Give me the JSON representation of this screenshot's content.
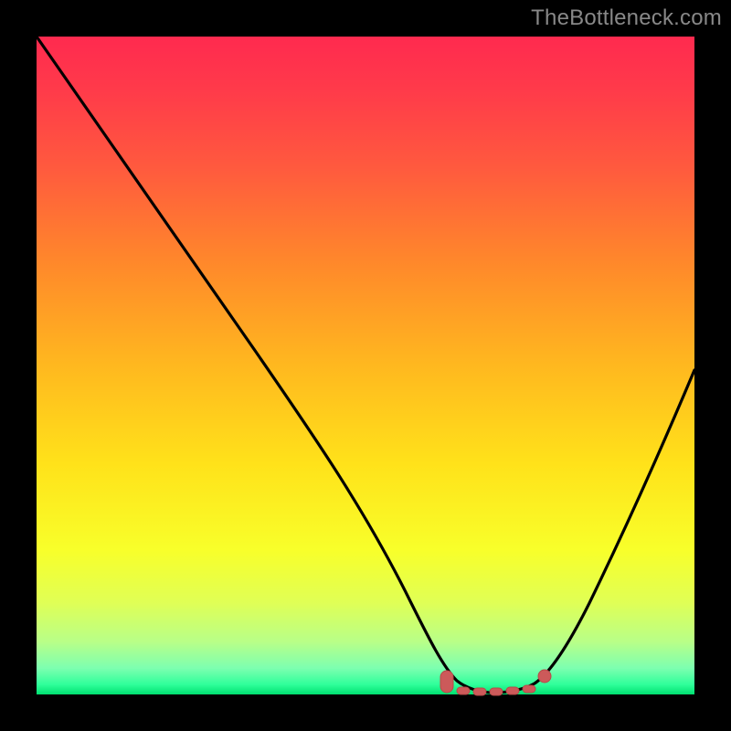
{
  "watermark": "TheBottleneck.com",
  "colors": {
    "curve_stroke": "#000000",
    "marker_fill": "#cc5a5a",
    "marker_stroke": "#b84848",
    "background": "#000000"
  },
  "chart_data": {
    "type": "line",
    "title": "",
    "xlabel": "",
    "ylabel": "",
    "xlim": [
      0,
      100
    ],
    "ylim": [
      0,
      100
    ],
    "grid": false,
    "legend": false,
    "axes_visble": false,
    "series": [
      {
        "name": "bottleneck-curve",
        "x": [
          0,
          5,
          10,
          15,
          20,
          25,
          30,
          35,
          40,
          45,
          50,
          55,
          60,
          62,
          65,
          68,
          70,
          73,
          76,
          80,
          85,
          90,
          95,
          100
        ],
        "values": [
          100,
          92,
          84,
          76,
          68,
          60,
          52,
          44,
          36,
          28,
          20,
          13,
          6,
          3,
          1,
          0,
          0,
          0,
          1,
          4,
          12,
          22,
          34,
          49
        ]
      }
    ],
    "markers": [
      {
        "name": "flat-start",
        "x": 62,
        "y": 2.5,
        "shape": "round-rect"
      },
      {
        "name": "flat-mid1",
        "x": 65,
        "y": 1.2,
        "shape": "dot"
      },
      {
        "name": "flat-mid2",
        "x": 68,
        "y": 0.8,
        "shape": "dot"
      },
      {
        "name": "flat-mid3",
        "x": 71,
        "y": 0.8,
        "shape": "dot"
      },
      {
        "name": "flat-mid4",
        "x": 74,
        "y": 1.2,
        "shape": "dot"
      },
      {
        "name": "flat-end",
        "x": 77,
        "y": 2.2,
        "shape": "round-dot"
      }
    ],
    "gradient_stops": [
      {
        "pos": 0.0,
        "color": "#ff2a4f"
      },
      {
        "pos": 0.35,
        "color": "#ff8a2a"
      },
      {
        "pos": 0.65,
        "color": "#ffe21a"
      },
      {
        "pos": 0.92,
        "color": "#b8ff88"
      },
      {
        "pos": 1.0,
        "color": "#00e070"
      }
    ]
  }
}
